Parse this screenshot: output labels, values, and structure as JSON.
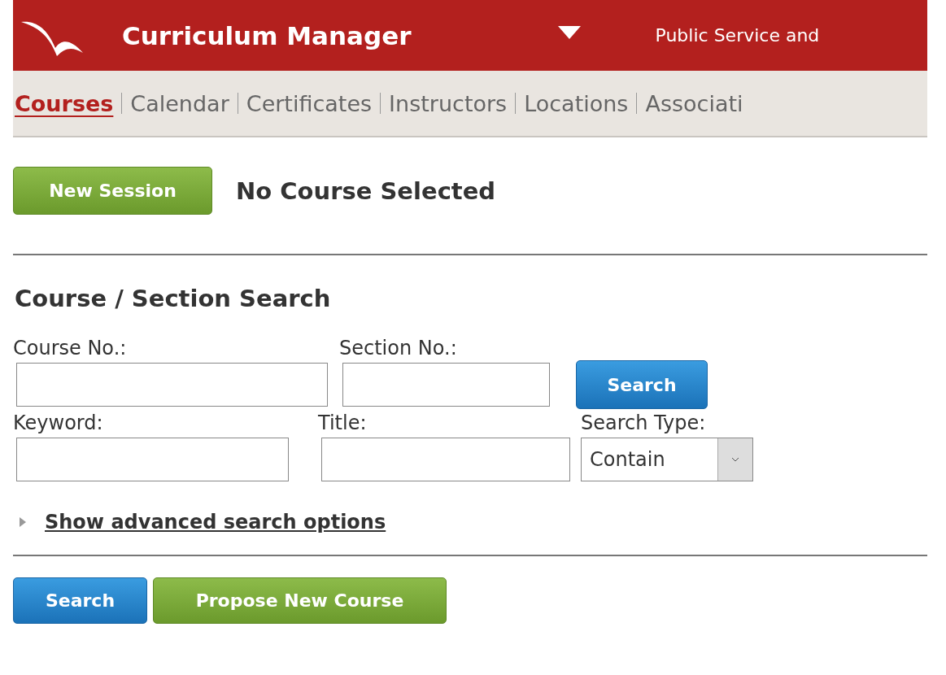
{
  "header": {
    "title": "Curriculum Manager",
    "tagline": "Public Service and"
  },
  "nav": [
    {
      "label": "Courses",
      "selected": true
    },
    {
      "label": "Calendar",
      "selected": false
    },
    {
      "label": "Certificates",
      "selected": false
    },
    {
      "label": "Instructors",
      "selected": false
    },
    {
      "label": "Locations",
      "selected": false
    },
    {
      "label": "Associati",
      "selected": false
    }
  ],
  "new_session_button": "New Session",
  "course_status": "No Course Selected",
  "search_heading": "Course / Section Search",
  "search_rows": [
    {
      "fields": [
        {
          "label": "Course No.:",
          "kind": "text"
        },
        {
          "label": "Section No.:",
          "kind": "text"
        },
        {
          "kind": "button",
          "label": "Search"
        }
      ]
    },
    {
      "fields": [
        {
          "label": "Keyword:",
          "kind": "text"
        },
        {
          "label": "Title:",
          "kind": "text"
        },
        {
          "label": "Search Type:",
          "kind": "select",
          "value": "Contain"
        }
      ]
    }
  ],
  "advanced_link": "Show advanced search options",
  "buttons": [
    {
      "label": "Search",
      "kind": "primary"
    },
    {
      "label": "Propose New Course",
      "kind": "secondary"
    }
  ]
}
